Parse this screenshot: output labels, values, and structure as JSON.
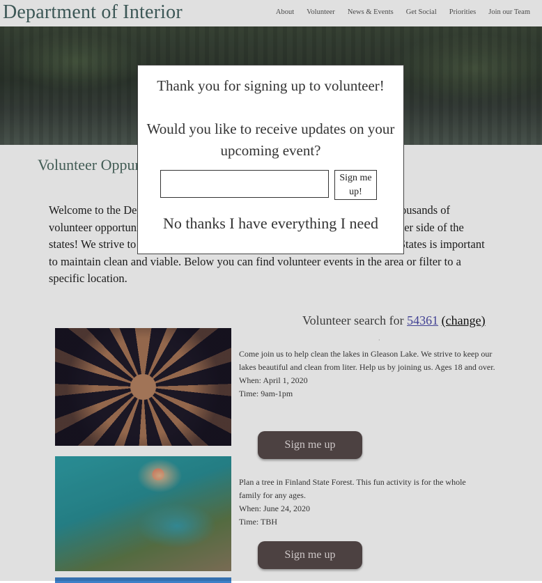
{
  "header": {
    "brand": "Department of Interior",
    "nav": [
      "About",
      "Volunteer",
      "News & Events",
      "Get Social",
      "Priorities",
      "Join our Team"
    ]
  },
  "main": {
    "section_title": "Volunteer Oppurtunities",
    "intro": "Welcome to the Department of Interior volunteer page. Here you will find thousands of volunteer opportunities across the country. Whether you're local or on the other side of the states! We strive to show that preserving the natural resources of the United States is important to maintain clean and viable. Below you can find volunteer events in the area or filter to a specific location.",
    "search_prefix": "Volunteer search for",
    "zip": "54361",
    "change_label": "(change)",
    "separator": "·"
  },
  "events": [
    {
      "description": "Come join us to help clean the lakes in Gleason Lake. We strive to keep our lakes beautiful and clean from liter. Help us by joining us. Ages 18 and over.",
      "when": "When: April 1, 2020",
      "time": "Time: 9am-1pm",
      "button": "Sign me up"
    },
    {
      "description": "Plan a tree in Finland State Forest. This fun activity is for the whole family for any ages.",
      "when": "When: June 24, 2020",
      "time": "Time: TBH",
      "button": "Sign me up"
    }
  ],
  "modal": {
    "line1": "Thank you for signing up to volunteer!",
    "line2": "Would you like to receive updates on your upcoming event?",
    "input_value": "",
    "button": "Sign me up!",
    "decline": "No thanks I have everything I need"
  }
}
